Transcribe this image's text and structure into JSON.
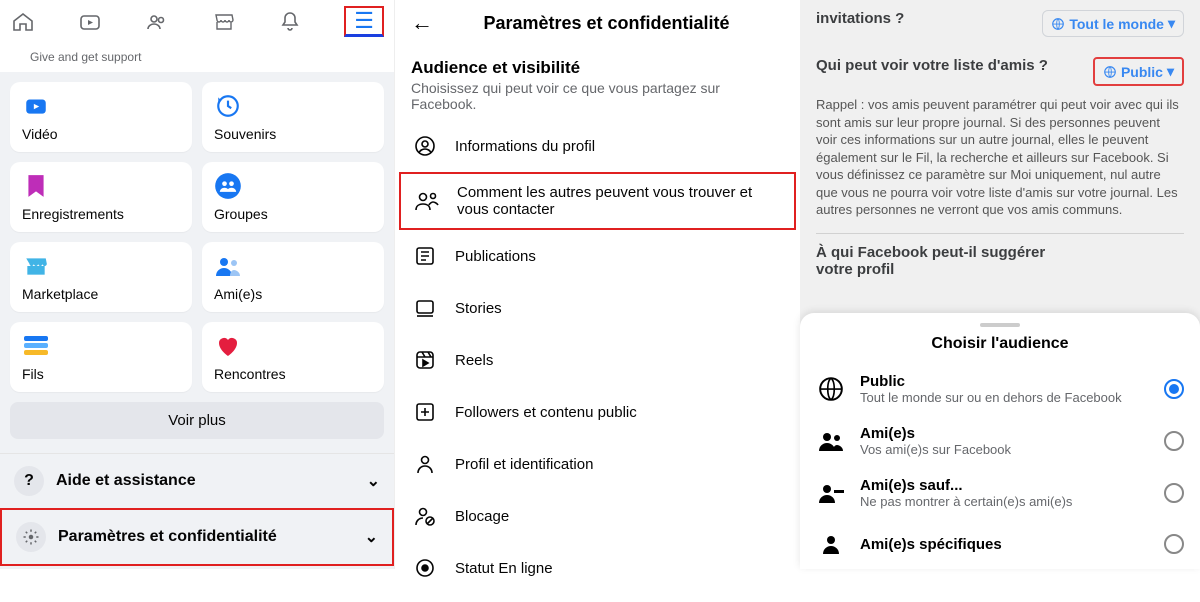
{
  "pane1": {
    "give_support": "Give and get support",
    "tiles": [
      {
        "label": "Vidéo"
      },
      {
        "label": "Souvenirs"
      },
      {
        "label": "Enregistrements"
      },
      {
        "label": "Groupes"
      },
      {
        "label": "Marketplace"
      },
      {
        "label": "Ami(e)s"
      },
      {
        "label": "Fils"
      },
      {
        "label": "Rencontres"
      }
    ],
    "voir_plus": "Voir plus",
    "help": "Aide et assistance",
    "settings": "Paramètres et confidentialité"
  },
  "pane2": {
    "title": "Paramètres et confidentialité",
    "section_title": "Audience et visibilité",
    "section_desc": "Choisissez qui peut voir ce que vous partagez sur Facebook.",
    "items": [
      "Informations du profil",
      "Comment les autres peuvent vous trouver et vous contacter",
      "Publications",
      "Stories",
      "Reels",
      "Followers et contenu public",
      "Profil et identification",
      "Blocage",
      "Statut En ligne"
    ]
  },
  "pane3": {
    "top_pill": "Tout le monde",
    "q_invitations": "invitations ?",
    "q_friends": "Qui peut voir votre liste d'amis ?",
    "pill_public": "Public",
    "note": "Rappel : vos amis peuvent paramétrer qui peut voir avec qui ils sont amis sur leur propre journal. Si des personnes peuvent voir ces informations sur un autre journal, elles le peuvent également sur le Fil, la recherche et ailleurs sur Facebook. Si vous définissez ce paramètre sur Moi uniquement, nul autre que vous ne pourra voir votre liste d'amis sur votre journal. Les autres personnes ne verront que vos amis communs.",
    "q_suggest": "À qui Facebook peut-il suggérer votre profil",
    "sheet_title": "Choisir l'audience",
    "options": [
      {
        "title": "Public",
        "sub": "Tout le monde sur ou en dehors de Facebook",
        "selected": true
      },
      {
        "title": "Ami(e)s",
        "sub": "Vos ami(e)s sur Facebook",
        "selected": false
      },
      {
        "title": "Ami(e)s sauf...",
        "sub": "Ne pas montrer à certain(e)s ami(e)s",
        "selected": false
      },
      {
        "title": "Ami(e)s spécifiques",
        "sub": "",
        "selected": false
      }
    ]
  }
}
